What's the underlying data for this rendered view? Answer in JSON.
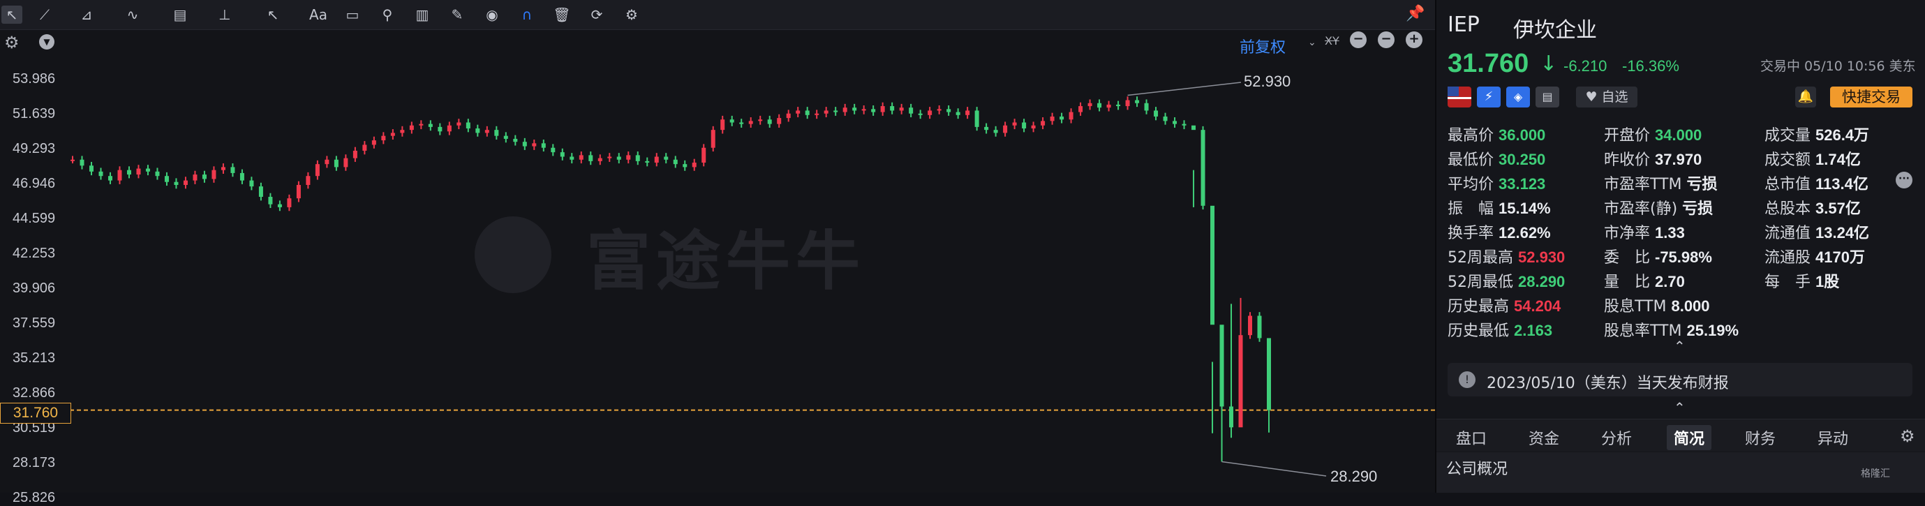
{
  "toolbar": {
    "tools": [
      "cursor-icon",
      "line-tool-icon",
      "channel-tool-icon",
      "wave-tool-icon",
      "fib-tool-icon",
      "measure-tool-icon",
      "arrow-tool-icon",
      "text-tool-icon",
      "comment-tool-icon",
      "zoom-icon",
      "chart-tool-icon",
      "pencil-icon",
      "eye-icon",
      "magnet-icon",
      "trash-icon",
      "sync-icon",
      "gear-icon"
    ],
    "text_tool_label": "Aa"
  },
  "chart": {
    "adjust_label": "前复权",
    "xy_label": "XY",
    "y_ticks": [
      "53.986",
      "51.639",
      "49.293",
      "46.946",
      "44.599",
      "42.253",
      "39.906",
      "37.559",
      "35.213",
      "32.866",
      "30.519",
      "28.173",
      "25.826"
    ],
    "current_price_tag": "31.760",
    "high_annotation": "52.930",
    "low_annotation": "28.290",
    "watermark": "富途牛牛",
    "colors": {
      "up": "#f0394d",
      "down": "#3fcf79",
      "price_line": "#e8a33b"
    }
  },
  "chart_data": {
    "type": "candlestick",
    "ylim": [
      25.826,
      53.986
    ],
    "current": 31.76,
    "high_52w": 52.93,
    "low_52w": 28.29,
    "closes": [
      48.6,
      48.2,
      47.8,
      47.5,
      47.2,
      47.9,
      47.6,
      48.0,
      47.8,
      47.5,
      47.1,
      46.9,
      47.2,
      47.6,
      47.3,
      47.9,
      48.1,
      47.7,
      47.2,
      46.8,
      46.1,
      45.6,
      45.4,
      46.0,
      46.9,
      47.5,
      48.3,
      48.6,
      48.1,
      48.7,
      49.2,
      49.6,
      49.9,
      50.2,
      50.4,
      50.6,
      50.9,
      51.0,
      50.8,
      50.5,
      50.9,
      51.1,
      50.7,
      50.4,
      50.6,
      50.2,
      50.0,
      49.8,
      49.5,
      49.7,
      49.4,
      49.1,
      48.8,
      48.6,
      48.9,
      48.5,
      48.7,
      48.8,
      48.6,
      48.9,
      48.5,
      48.4,
      48.8,
      48.6,
      48.3,
      48.1,
      48.4,
      49.4,
      50.6,
      51.3,
      51.1,
      51.0,
      51.2,
      51.3,
      51.0,
      51.4,
      51.7,
      51.9,
      51.6,
      51.7,
      51.9,
      51.8,
      52.1,
      51.9,
      52.0,
      51.8,
      52.2,
      51.9,
      52.1,
      51.7,
      51.6,
      51.9,
      52.0,
      51.8,
      51.6,
      51.9,
      50.8,
      50.6,
      50.4,
      50.9,
      51.1,
      50.7,
      50.9,
      51.2,
      51.5,
      51.3,
      51.8,
      52.2,
      52.4,
      52.1,
      52.3,
      52.2,
      52.6,
      52.4,
      51.9,
      51.5,
      51.2,
      51.0,
      50.9,
      50.6,
      45.5,
      37.5,
      32.0,
      30.6,
      36.8,
      38.1,
      36.6,
      31.76
    ]
  },
  "info": {
    "ticker": "IEP",
    "name": "伊坎企业",
    "price": "31.760",
    "change": "-6.210",
    "change_pct": "-16.36%",
    "status": "交易中 05/10 10:56 美东",
    "watch_label": "自选",
    "trade_label": "快捷交易",
    "stats": [
      {
        "k": "最高价",
        "v": "36.000",
        "c": "grn"
      },
      {
        "k": "开盘价",
        "v": "34.000",
        "c": "grn"
      },
      {
        "k": "成交量",
        "v": "526.4万",
        "c": ""
      },
      {
        "k": "最低价",
        "v": "30.250",
        "c": "grn"
      },
      {
        "k": "昨收价",
        "v": "37.970",
        "c": ""
      },
      {
        "k": "成交额",
        "v": "1.74亿",
        "c": ""
      },
      {
        "k": "平均价",
        "v": "33.123",
        "c": "grn"
      },
      {
        "k": "市盈率TTM",
        "v": "亏损",
        "c": ""
      },
      {
        "k": "总市值",
        "v": "113.4亿",
        "c": ""
      },
      {
        "k": "振　幅",
        "v": "15.14%",
        "c": ""
      },
      {
        "k": "市盈率(静)",
        "v": "亏损",
        "c": ""
      },
      {
        "k": "总股本",
        "v": "3.57亿",
        "c": ""
      },
      {
        "k": "换手率",
        "v": "12.62%",
        "c": ""
      },
      {
        "k": "市净率",
        "v": "1.33",
        "c": ""
      },
      {
        "k": "流通值",
        "v": "13.24亿",
        "c": ""
      },
      {
        "k": "52周最高",
        "v": "52.930",
        "c": "red"
      },
      {
        "k": "委　比",
        "v": "-75.98%",
        "c": ""
      },
      {
        "k": "流通股",
        "v": "4170万",
        "c": ""
      },
      {
        "k": "52周最低",
        "v": "28.290",
        "c": "grn"
      },
      {
        "k": "量　比",
        "v": "2.70",
        "c": ""
      },
      {
        "k": "每　手",
        "v": "1股",
        "c": ""
      },
      {
        "k": "历史最高",
        "v": "54.204",
        "c": "red"
      },
      {
        "k": "股息TTM",
        "v": "8.000",
        "c": ""
      },
      {
        "k": "",
        "v": "",
        "c": ""
      },
      {
        "k": "历史最低",
        "v": "2.163",
        "c": "grn"
      },
      {
        "k": "股息率TTM",
        "v": "25.19%",
        "c": ""
      },
      {
        "k": "",
        "v": "",
        "c": ""
      }
    ],
    "earnings_notice": "2023/05/10（美东）当天发布财报",
    "tabs": [
      "盘口",
      "资金",
      "分析",
      "简况",
      "财务",
      "异动"
    ],
    "active_tab": "简况",
    "overview_label": "公司概况",
    "corner_logo": "格隆汇"
  }
}
